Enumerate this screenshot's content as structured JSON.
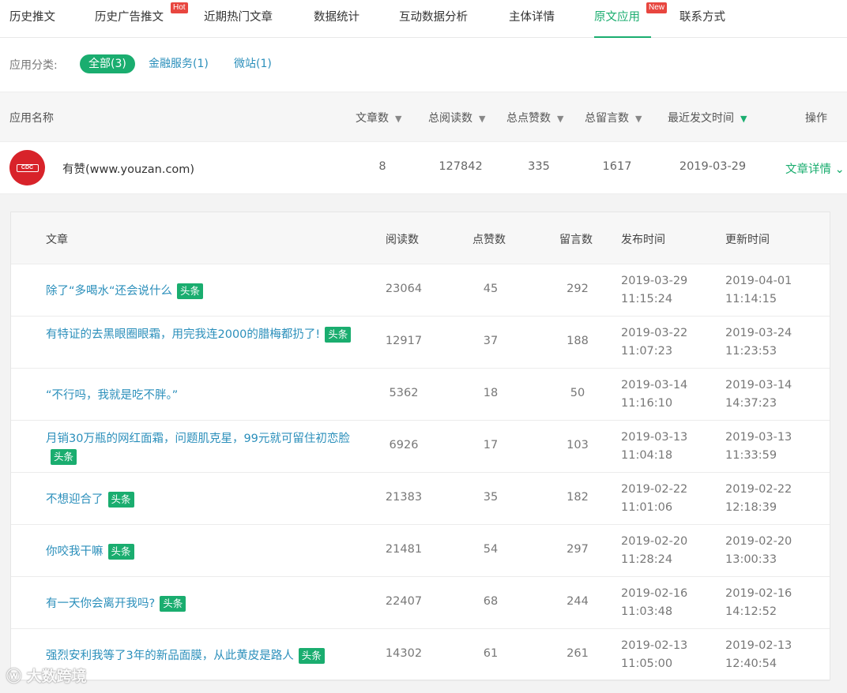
{
  "tabs": [
    {
      "label": "历史推文"
    },
    {
      "label": "历史广告推文",
      "badge": "Hot"
    },
    {
      "label": "近期热门文章"
    },
    {
      "label": "数据统计"
    },
    {
      "label": "互动数据分析"
    },
    {
      "label": "主体详情"
    },
    {
      "label": "原文应用",
      "badge": "New"
    },
    {
      "label": "联系方式"
    }
  ],
  "filter": {
    "label": "应用分类:",
    "chips": [
      "全部(3)",
      "金融服务(1)",
      "微站(1)"
    ]
  },
  "list_head": {
    "name": "应用名称",
    "articles": "文章数",
    "reads": "总阅读数",
    "likes": "总点赞数",
    "comments": "总留言数",
    "latest": "最近发文时间",
    "action": "操作"
  },
  "app": {
    "logo_text": "CDC",
    "name": "有赞(www.youzan.com)",
    "articles": "8",
    "reads": "127842",
    "likes": "335",
    "comments": "1617",
    "latest": "2019-03-29",
    "detail": "文章详情"
  },
  "sub_head": {
    "article": "文章",
    "reads": "阅读数",
    "likes": "点赞数",
    "comments": "留言数",
    "published": "发布时间",
    "updated": "更新时间"
  },
  "tag_label": "头条",
  "rows": [
    {
      "title": "除了“多喝水“还会说什么",
      "reads": "23064",
      "likes": "45",
      "comments": "292",
      "pub_date": "2019-03-29",
      "pub_time": "11:15:24",
      "upd_date": "2019-04-01",
      "upd_time": "11:14:15"
    },
    {
      "title": "有特证的去黑眼圈眼霜，用完我连2000的腊梅都扔了!",
      "reads": "12917",
      "likes": "37",
      "comments": "188",
      "pub_date": "2019-03-22",
      "pub_time": "11:07:23",
      "upd_date": "2019-03-24",
      "upd_time": "11:23:53"
    },
    {
      "title": "“不行吗，我就是吃不胖。”",
      "reads": "5362",
      "likes": "18",
      "comments": "50",
      "pub_date": "2019-03-14",
      "pub_time": "11:16:10",
      "upd_date": "2019-03-14",
      "upd_time": "14:37:23"
    },
    {
      "title": "月销30万瓶的网红面霜，问题肌克星，99元就可留住初恋脸",
      "reads": "6926",
      "likes": "17",
      "comments": "103",
      "pub_date": "2019-03-13",
      "pub_time": "11:04:18",
      "upd_date": "2019-03-13",
      "upd_time": "11:33:59"
    },
    {
      "title": "不想迎合了",
      "reads": "21383",
      "likes": "35",
      "comments": "182",
      "pub_date": "2019-02-22",
      "pub_time": "11:01:06",
      "upd_date": "2019-02-22",
      "upd_time": "12:18:39"
    },
    {
      "title": "你咬我干嘛",
      "reads": "21481",
      "likes": "54",
      "comments": "297",
      "pub_date": "2019-02-20",
      "pub_time": "11:28:24",
      "upd_date": "2019-02-20",
      "upd_time": "13:00:33"
    },
    {
      "title": "有一天你会离开我吗?",
      "reads": "22407",
      "likes": "68",
      "comments": "244",
      "pub_date": "2019-02-16",
      "pub_time": "11:03:48",
      "upd_date": "2019-02-16",
      "upd_time": "14:12:52"
    },
    {
      "title": "强烈安利我等了3年的新品面膜，从此黄皮是路人",
      "reads": "14302",
      "likes": "61",
      "comments": "261",
      "pub_date": "2019-02-13",
      "pub_time": "11:05:00",
      "upd_date": "2019-02-13",
      "upd_time": "12:40:54"
    }
  ],
  "watermark": "大数跨境",
  "colors": {
    "accent": "#1aad6f",
    "link": "#2b8fbb",
    "badge": "#e8463f"
  }
}
